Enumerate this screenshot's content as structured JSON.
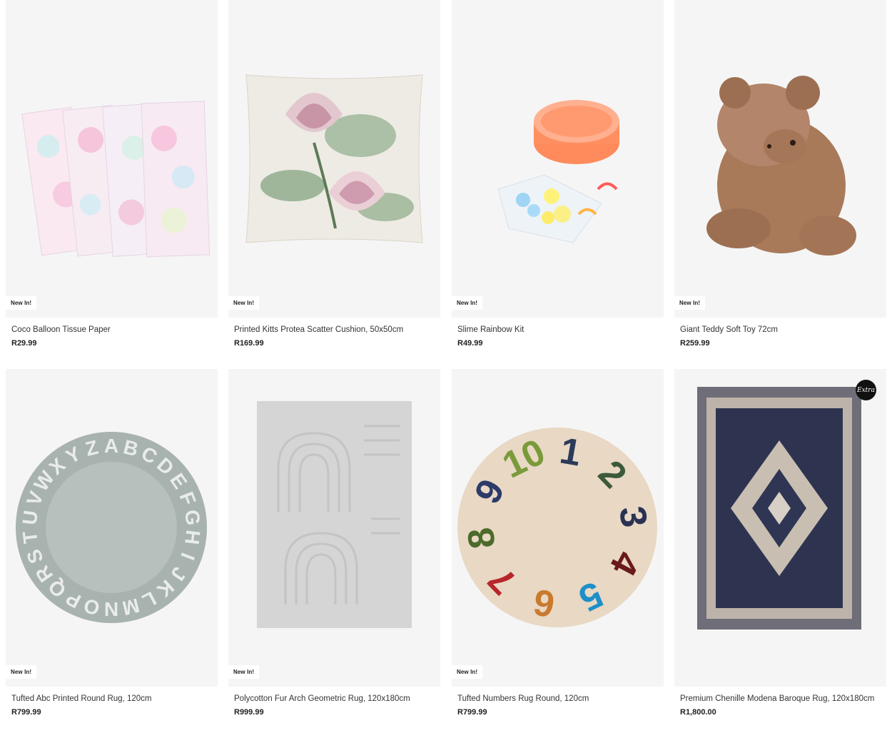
{
  "products": [
    {
      "title": "Coco Balloon Tissue Paper",
      "price": "R29.99",
      "badge": "New In!"
    },
    {
      "title": "Printed Kitts Protea Scatter Cushion, 50x50cm",
      "price": "R169.99",
      "badge": "New In!"
    },
    {
      "title": "Slime Rainbow Kit",
      "price": "R49.99",
      "badge": "New In!"
    },
    {
      "title": "Giant Teddy Soft Toy 72cm",
      "price": "R259.99",
      "badge": "New In!"
    },
    {
      "title": "Tufted Abc Printed Round Rug, 120cm",
      "price": "R799.99",
      "badge": "New In!"
    },
    {
      "title": "Polycotton Fur Arch Geometric Rug, 120x180cm",
      "price": "R999.99",
      "badge": "New In!"
    },
    {
      "title": "Tufted Numbers Rug Round, 120cm",
      "price": "R799.99",
      "badge": "New In!"
    },
    {
      "title": "Premium Chenille Modena Baroque Rug, 120x180cm",
      "price": "R1,800.00",
      "badge_logo": "Extra"
    }
  ],
  "rug_letters": "ABCDEFGHIJKLMNOPQRSTUVWXYZ",
  "rug_numbers": [
    "1",
    "2",
    "3",
    "4",
    "5",
    "6",
    "7",
    "8",
    "9",
    "10"
  ],
  "colors": {
    "image_bg": "#f5f5f5",
    "badge_bg": "#ffffff",
    "text": "#333333"
  }
}
